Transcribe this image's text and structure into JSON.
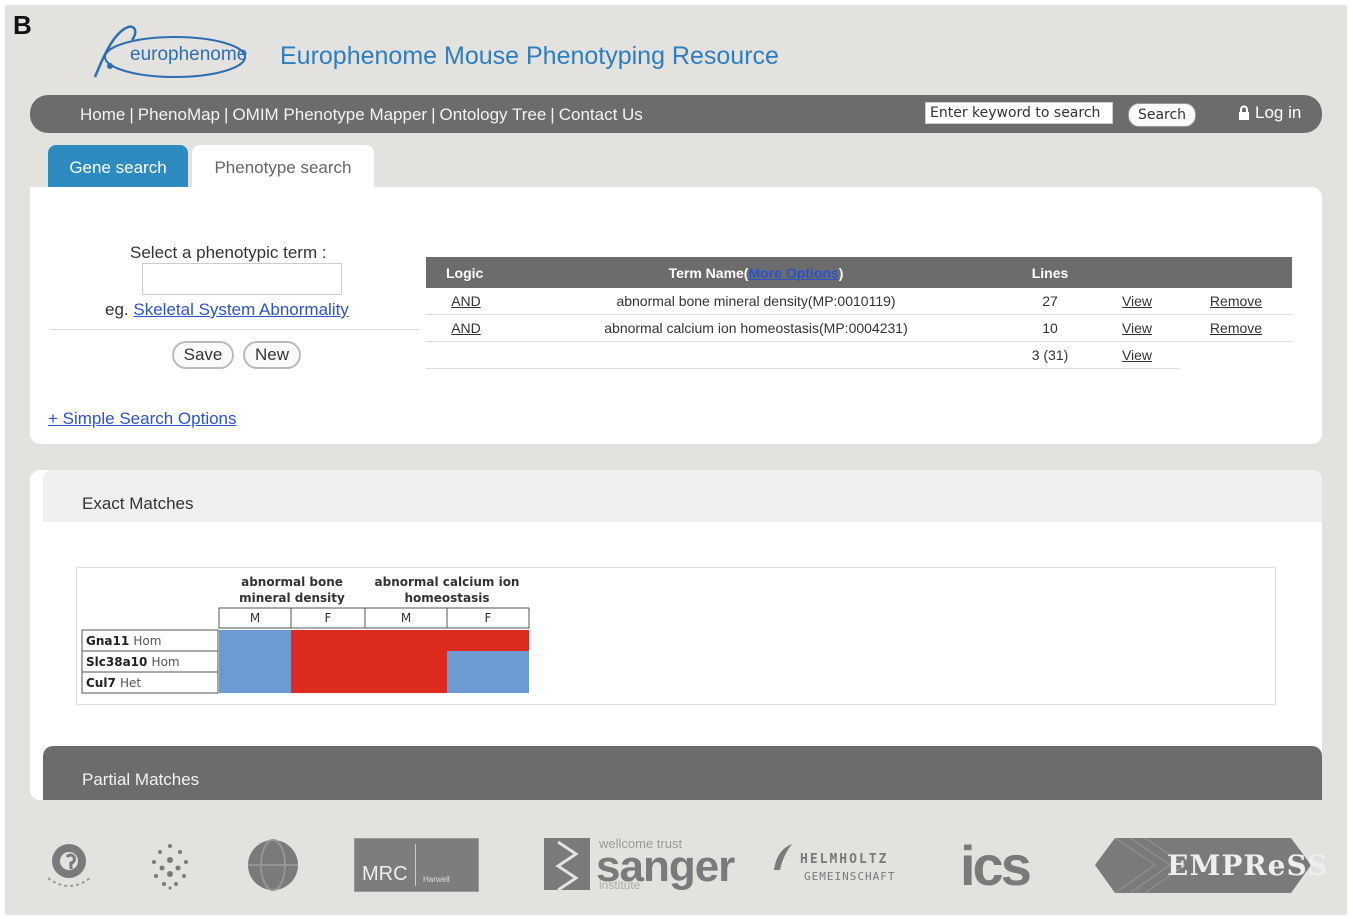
{
  "panel_label": "B",
  "logo": {
    "text": "europhenome"
  },
  "site_title": "Europhenome Mouse Phenotyping Resource",
  "nav": {
    "links": [
      "Home",
      "PhenoMap",
      "OMIM Phenotype Mapper",
      "Ontology Tree",
      "Contact Us"
    ],
    "separator": "|",
    "search_placeholder": "Enter keyword to search",
    "search_button": "Search",
    "login": "Log in"
  },
  "tabs": {
    "gene": "Gene search",
    "phenotype": "Phenotype search"
  },
  "search_form": {
    "select_label": "Select a phenotypic term :",
    "eg_prefix": "eg.",
    "eg_link": "Skeletal System Abnormality",
    "save": "Save",
    "new": "New",
    "simple_options": "+ Simple Search Options"
  },
  "term_table": {
    "headers": {
      "logic": "Logic",
      "term_name": "Term Name(",
      "more_options": "More Options",
      "term_name_close": ")",
      "lines": "Lines"
    },
    "rows": [
      {
        "logic": "AND",
        "term": "abnormal bone mineral density(MP:0010119)",
        "lines": "27",
        "view": "View",
        "remove": "Remove"
      },
      {
        "logic": "AND",
        "term": "abnormal calcium ion homeostasis(MP:0004231)",
        "lines": "10",
        "view": "View",
        "remove": "Remove"
      }
    ],
    "total": {
      "lines": "3 (31)",
      "view": "View"
    }
  },
  "exact_matches": {
    "title": "Exact Matches",
    "columns": [
      {
        "term_line1": "abnormal bone",
        "term_line2": "mineral density",
        "sexes": [
          "M",
          "F"
        ]
      },
      {
        "term_line1": "abnormal calcium ion",
        "term_line2": "homeostasis",
        "sexes": [
          "M",
          "F"
        ]
      }
    ],
    "rows": [
      {
        "gene": "Gna11",
        "zygosity": "Hom",
        "cells": [
          "blue",
          "red",
          "red",
          "red"
        ]
      },
      {
        "gene": "Slc38a10",
        "zygosity": "Hom",
        "cells": [
          "blue",
          "red",
          "red",
          "blue"
        ]
      },
      {
        "gene": "Cul7",
        "zygosity": "Het",
        "cells": [
          "blue",
          "red",
          "red",
          "blue"
        ]
      }
    ],
    "colors": {
      "red": "#dc2a1e",
      "blue": "#6b9bd2"
    }
  },
  "partial_matches": {
    "title": "Partial Matches"
  },
  "footer_logos": {
    "mrc": {
      "main": "MRC",
      "sub": "Harwell"
    },
    "sanger": {
      "top": "wellcome trust",
      "main": "sanger",
      "sub": "institute"
    },
    "helmholtz": {
      "line1": "HELMHOLTZ",
      "line2": "GEMEINSCHAFT"
    },
    "ics": "ics",
    "empress": "EMPReSS"
  },
  "colors": {
    "accent_tab": "#2e8bbf",
    "nav_gray": "#6c6c6c",
    "link_blue": "#2b53c9",
    "title_blue": "#2b7fc1"
  }
}
